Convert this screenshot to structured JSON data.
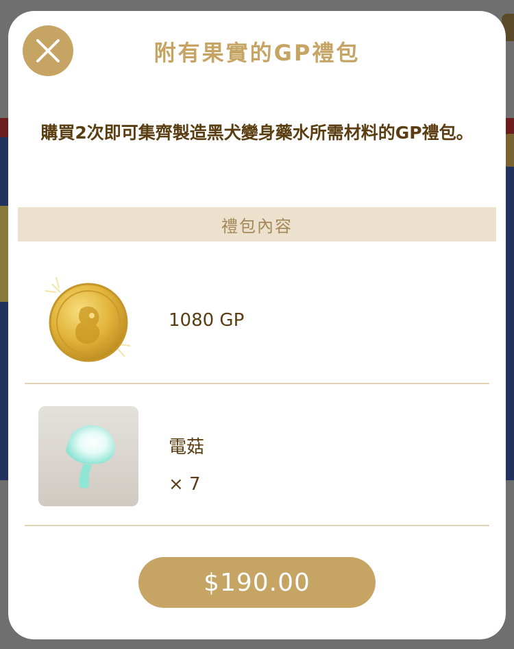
{
  "dialog": {
    "title": "附有果實的GP禮包",
    "description": "購買2次即可集齊製造黑犬變身藥水所需材料的GP禮包。",
    "section_header": "禮包內容",
    "items": [
      {
        "name": "1080 GP",
        "icon": "gold-coin-icon",
        "quantity": ""
      },
      {
        "name": "電菇",
        "icon": "mushroom-icon",
        "quantity": "× 7"
      }
    ],
    "price_label": "$190.00",
    "close_icon": "close-icon"
  },
  "colors": {
    "accent": "#c5a464",
    "text_dark": "#5a3e12",
    "section_bg": "#ece1cc",
    "divider": "#e2d3b7"
  }
}
